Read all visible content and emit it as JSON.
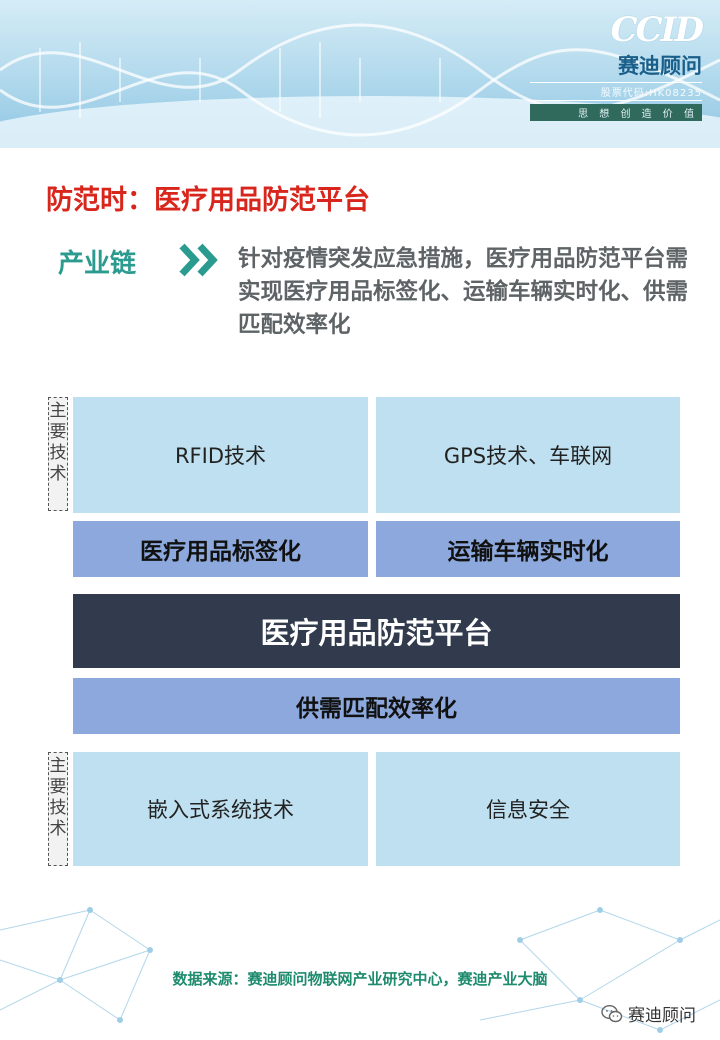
{
  "header": {
    "logo_mark": "CCID",
    "logo_name": "赛迪顾问",
    "stock_code": "股票代码:HK08235",
    "slogan": "思 想 创 造 价 值"
  },
  "title": "防范时：医疗用品防范平台",
  "chain": {
    "label": "产业链",
    "text": "针对疫情突发应急措施，医疗用品防范平台需实现医疗用品标签化、运输车辆实时化、供需匹配效率化"
  },
  "diagram": {
    "top_side_label": "主要技术",
    "bottom_side_label": "主要技术",
    "top_tech": [
      "RFID技术",
      "GPS技术、车联网"
    ],
    "mid_items": [
      "医疗用品标签化",
      "运输车辆实时化"
    ],
    "core": "医疗用品防范平台",
    "lower_mid": "供需匹配效率化",
    "bottom_tech": [
      "嵌入式系统技术",
      "信息安全"
    ]
  },
  "colors": {
    "title": "#d9261c",
    "chain_label": "#2b9a8f",
    "tech_box": "#bfe0f0",
    "mid_box": "#8ca8dc",
    "core_box": "#313b4d"
  },
  "footer": {
    "source": "数据来源：赛迪顾问物联网产业研究中心，赛迪产业大脑",
    "wechat_name": "赛迪顾问",
    "wechat_icon": "wechat-icon"
  }
}
